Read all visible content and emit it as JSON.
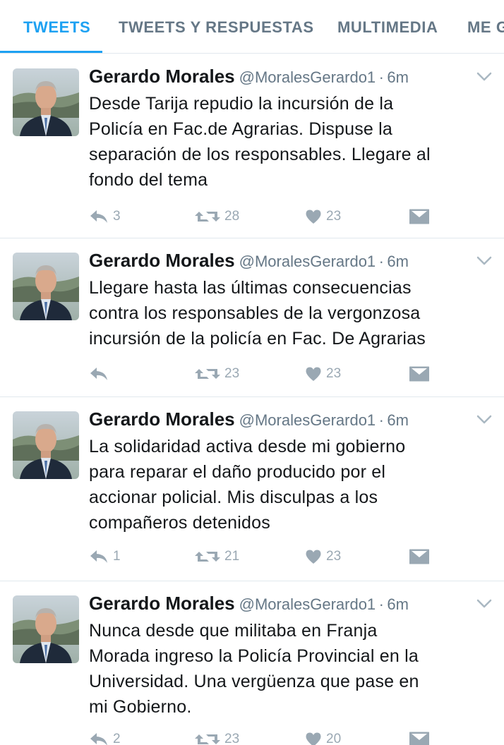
{
  "tabs": [
    {
      "label": "TWEETS",
      "active": true
    },
    {
      "label": "TWEETS Y RESPUESTAS",
      "active": false
    },
    {
      "label": "MULTIMEDIA",
      "active": false
    },
    {
      "label": "ME G",
      "active": false
    }
  ],
  "colors": {
    "accent": "#1da1f2",
    "text": "#14171a",
    "muted": "#657786",
    "action_grey": "#9aa8b3"
  },
  "tweets": [
    {
      "name": "Gerardo Morales",
      "handle": "@MoralesGerardo1",
      "separator": "·",
      "time": "6m",
      "lines": [
        "Desde Tarija repudio la incursión de la",
        "Policía en Fac.de Agrarias. Dispuse la",
        "separación de los responsables. Llegare al",
        "fondo del tema"
      ],
      "replies": "3",
      "retweets": "28",
      "likes": "23"
    },
    {
      "name": "Gerardo Morales",
      "handle": "@MoralesGerardo1",
      "separator": "·",
      "time": "6m",
      "lines": [
        "Llegare hasta las últimas consecuencias",
        "contra los responsables de la vergonzosa",
        "incursión de la policía en Fac. De Agrarias"
      ],
      "replies": "",
      "retweets": "23",
      "likes": "23"
    },
    {
      "name": "Gerardo Morales",
      "handle": "@MoralesGerardo1",
      "separator": "·",
      "time": "6m",
      "lines": [
        "La solidaridad activa desde mi gobierno",
        "para reparar el daño producido por el",
        "accionar policial. Mis disculpas a los",
        "compañeros detenidos"
      ],
      "replies": "1",
      "retweets": "21",
      "likes": "23"
    },
    {
      "name": "Gerardo Morales",
      "handle": "@MoralesGerardo1",
      "separator": "·",
      "time": "6m",
      "lines": [
        "Nunca desde que militaba en Franja",
        "Morada ingreso la Policía Provincial en la",
        "Universidad. Una vergüenza que pase en",
        "mi Gobierno."
      ],
      "replies": "2",
      "retweets": "23",
      "likes": "20"
    }
  ]
}
